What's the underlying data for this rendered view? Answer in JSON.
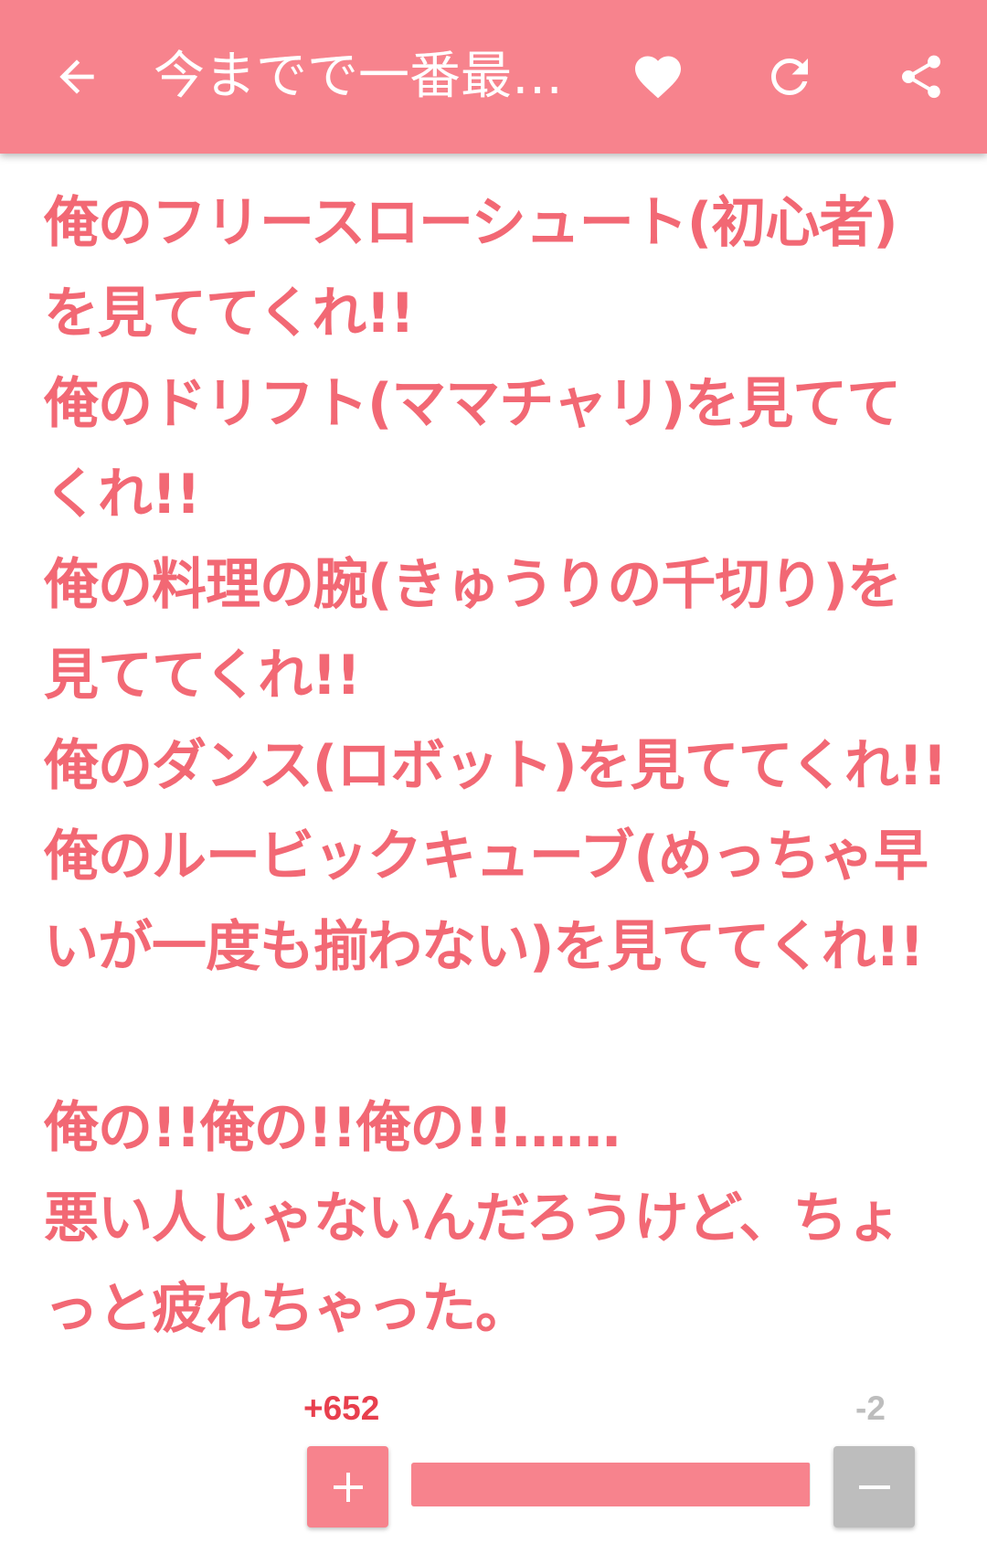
{
  "toolbar": {
    "title": "今までで一番最…",
    "icons": {
      "back": "arrow-left-icon",
      "favorite": "heart-icon",
      "reload": "refresh-icon",
      "share": "share-icon"
    }
  },
  "post": {
    "lines": [
      "俺のフリースローシュート(初心者)",
      "を見ててくれ!!",
      "俺のドリフト(ママチャリ)を見てて",
      "くれ!!",
      "俺の料理の腕(きゅうりの千切り)を",
      "見ててくれ!!",
      "俺のダンス(ロボット)を見ててくれ!!",
      "俺のルービックキューブ(めっちゃ早",
      "いが一度も揃わない)を見ててくれ!!",
      "",
      "俺の!!俺の!!俺の!!……",
      "悪い人じゃないんだろうけど、ちょ",
      "っと疲れちゃった。"
    ]
  },
  "votes": {
    "plus_count": "+652",
    "minus_count": "-2",
    "plus_label": "+",
    "minus_label": "−",
    "plus_ratio": 0.997
  },
  "colors": {
    "accent": "#f7838d",
    "text": "#f26874",
    "plus_count": "#e83f4d",
    "neutral": "#bdbdbd"
  }
}
